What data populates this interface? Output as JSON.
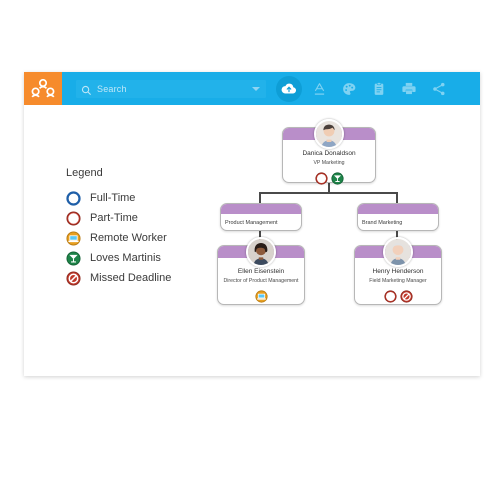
{
  "app": {
    "logo_icon": "org-chart-people-icon",
    "brand_color": "#f68b2c",
    "toolbar_color": "#18ade8"
  },
  "search": {
    "placeholder": "Search",
    "value": "",
    "icon": "search-icon",
    "caret_icon": "chevron-down-icon"
  },
  "toolbar": {
    "buttons": [
      {
        "name": "cloud-upload-button",
        "icon": "cloud-upload-icon",
        "active": true
      },
      {
        "name": "text-format-button",
        "icon": "text-underline-a-icon",
        "active": false
      },
      {
        "name": "theme-palette-button",
        "icon": "palette-icon",
        "active": false
      },
      {
        "name": "clipboard-button",
        "icon": "clipboard-icon",
        "active": false
      },
      {
        "name": "print-button",
        "icon": "printer-icon",
        "active": false
      },
      {
        "name": "share-button",
        "icon": "share-icon",
        "active": false
      }
    ]
  },
  "legend": {
    "title": "Legend",
    "items": [
      {
        "label": "Full-Time",
        "icon": "full-time-ring-icon",
        "color": "#1f5fa8"
      },
      {
        "label": "Part-Time",
        "icon": "part-time-half-moon-icon",
        "color": "#c0392b"
      },
      {
        "label": "Remote Worker",
        "icon": "remote-worker-laptop-icon",
        "color": "#e8a020"
      },
      {
        "label": "Loves Martinis",
        "icon": "martini-glass-icon",
        "color": "#1e8449"
      },
      {
        "label": "Missed Deadline",
        "icon": "missed-deadline-ban-icon",
        "color": "#c0392b"
      }
    ]
  },
  "chart_data": {
    "type": "org-chart",
    "header_color": "#b98ec9",
    "nodes": [
      {
        "id": "root",
        "kind": "person",
        "name": "Danica Donaldson",
        "title": "VP Marketing",
        "avatar": "avatar-danica",
        "badges": [
          "part-time-half-moon-icon",
          "martini-glass-icon"
        ]
      },
      {
        "id": "dept-pm",
        "kind": "department",
        "name": "Product Management",
        "parent": "root"
      },
      {
        "id": "dept-bm",
        "kind": "department",
        "name": "Brand Marketing",
        "parent": "root"
      },
      {
        "id": "ellen",
        "kind": "person",
        "parent": "dept-pm",
        "name": "Ellen Eisenstein",
        "title": "Director of Product Management",
        "avatar": "avatar-ellen",
        "badges": [
          "remote-worker-laptop-icon"
        ]
      },
      {
        "id": "henry",
        "kind": "person",
        "parent": "dept-bm",
        "name": "Henry Henderson",
        "title": "Field Marketing Manager",
        "avatar": "avatar-henry",
        "badges": [
          "part-time-half-moon-icon",
          "missed-deadline-ban-icon"
        ]
      }
    ]
  }
}
